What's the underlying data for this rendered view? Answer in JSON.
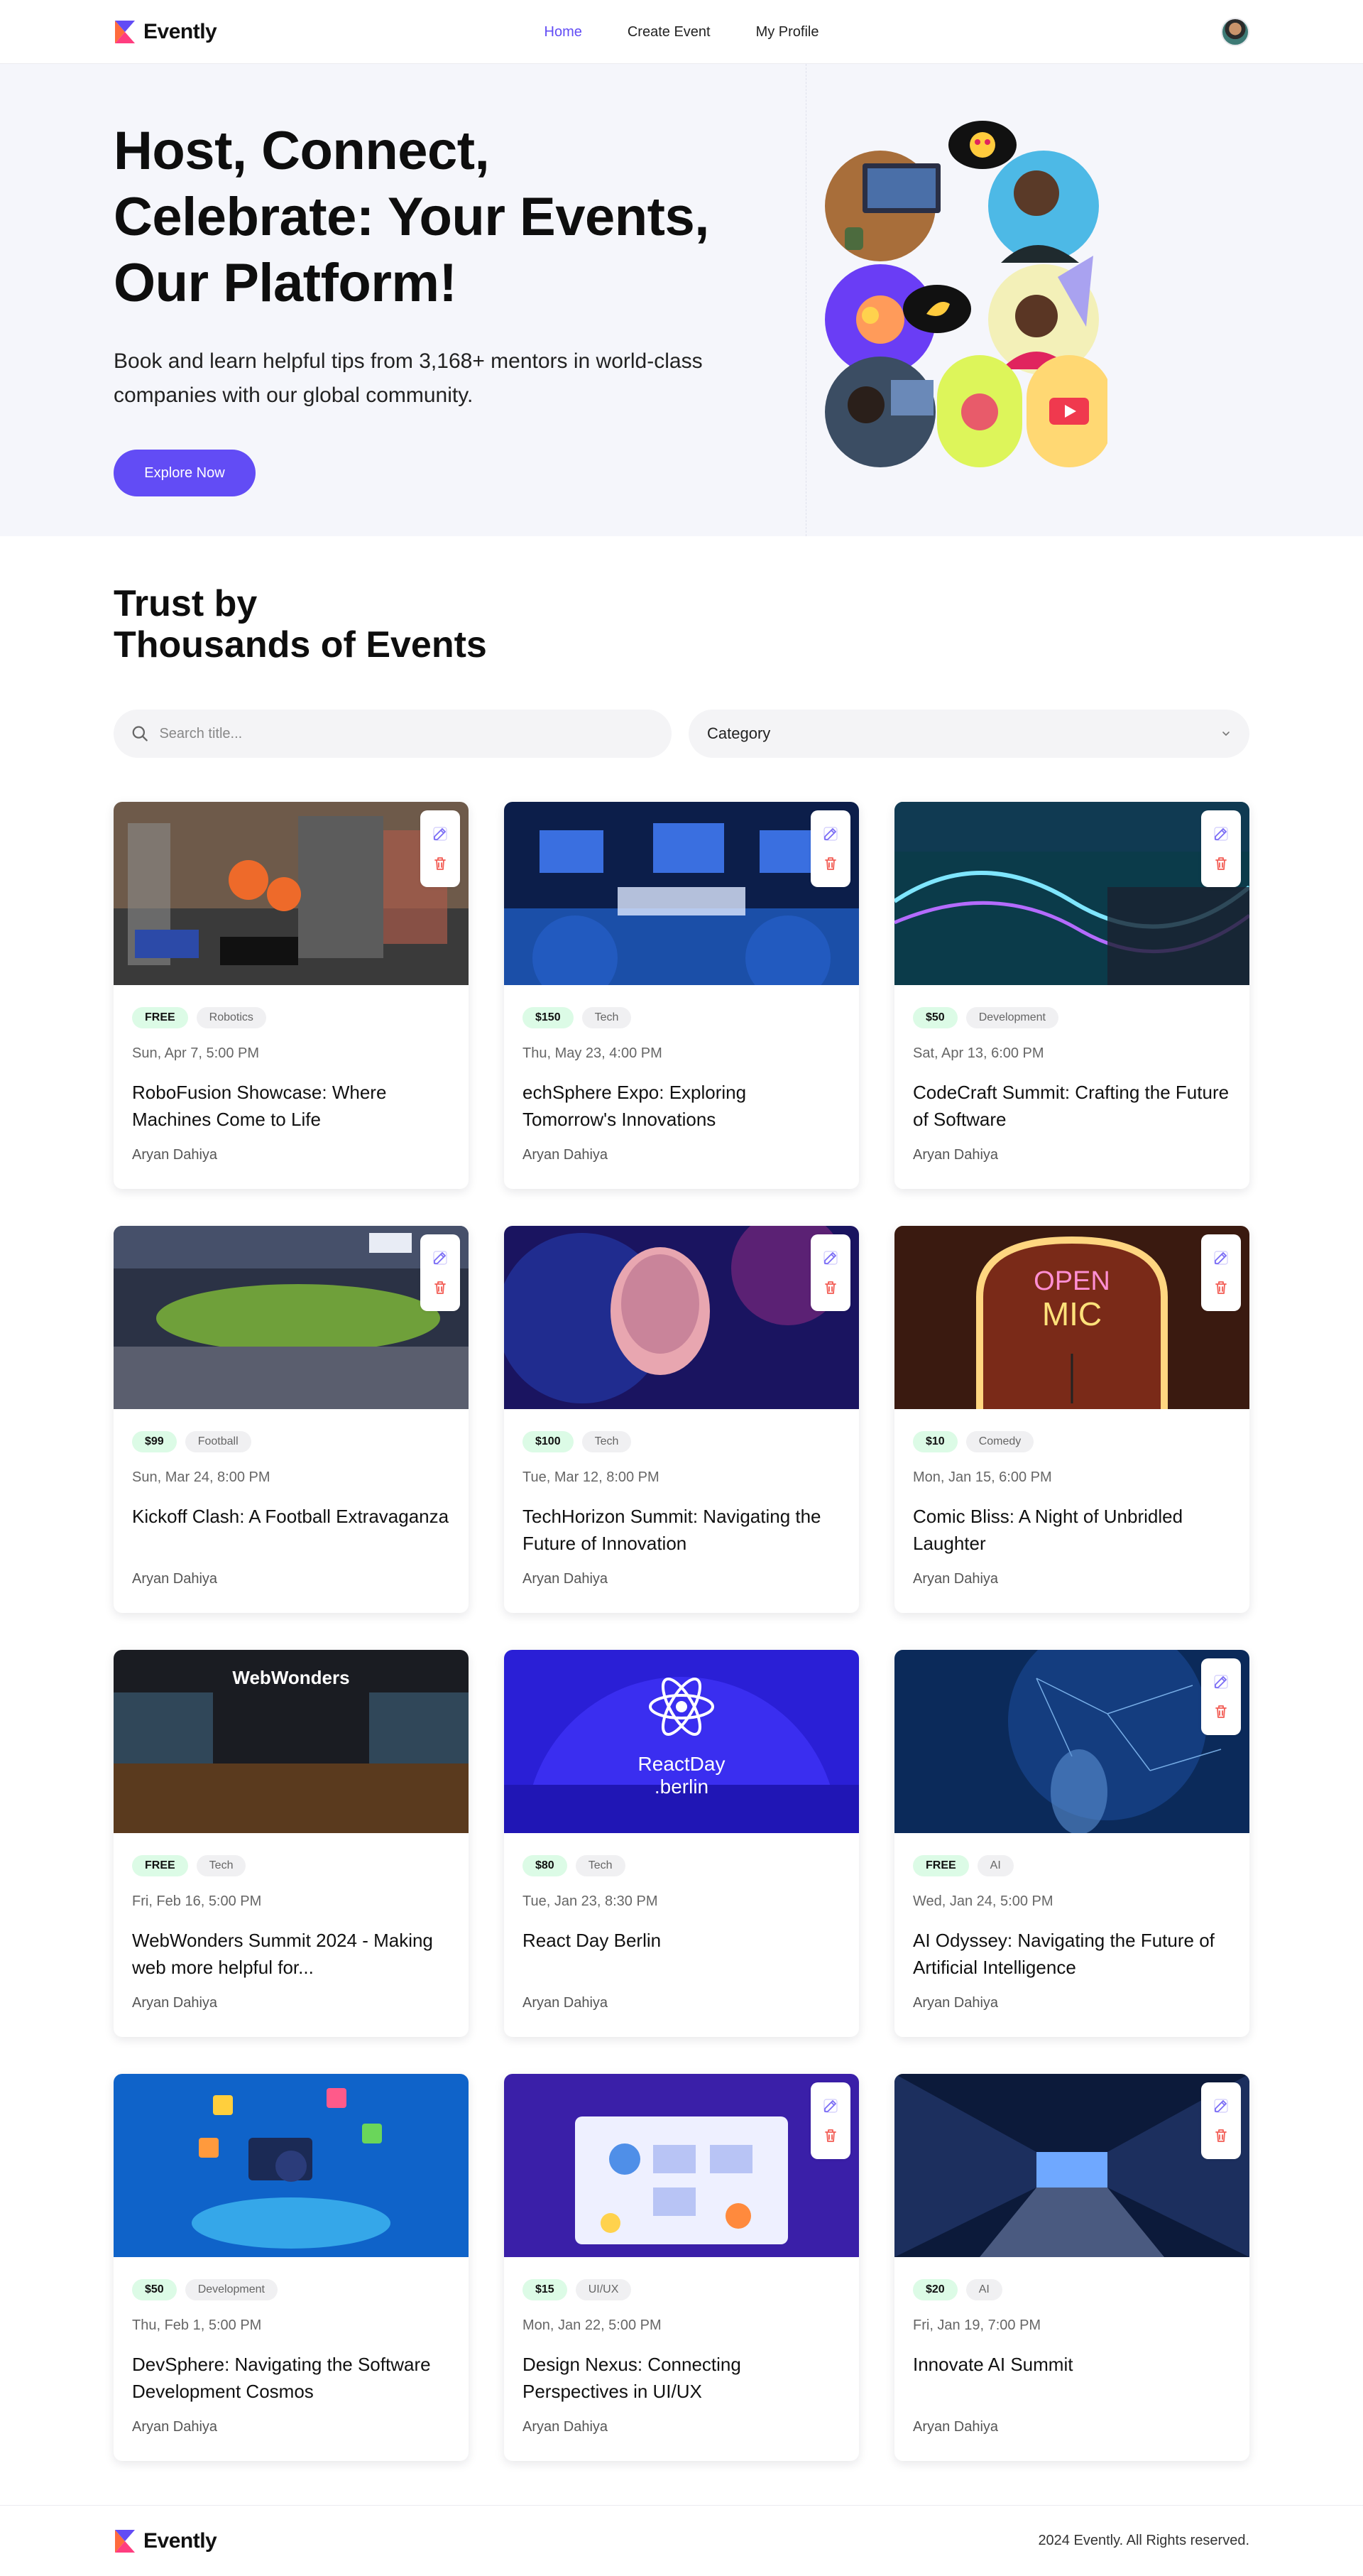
{
  "brand": {
    "name": "Evently",
    "accent": "#624cf5"
  },
  "nav": {
    "home": "Home",
    "create_event": "Create Event",
    "my_profile": "My Profile"
  },
  "hero": {
    "title": "Host, Connect, Celebrate: Your Events, Our Platform!",
    "subtitle": "Book and learn helpful tips from 3,168+ mentors in world-class companies with our global community.",
    "cta": "Explore Now"
  },
  "events_section": {
    "title_line1": "Trust by",
    "title_line2": "Thousands of Events",
    "search_placeholder": "Search title...",
    "category_placeholder": "Category"
  },
  "events": [
    {
      "price": "FREE",
      "category": "Robotics",
      "date": "Sun, Apr 7, 5:00 PM",
      "title": "RoboFusion Showcase: Where Machines Come to Life",
      "organizer": "Aryan Dahiya"
    },
    {
      "price": "$150",
      "category": "Tech",
      "date": "Thu, May 23, 4:00 PM",
      "title": "echSphere Expo: Exploring Tomorrow's Innovations",
      "organizer": "Aryan Dahiya"
    },
    {
      "price": "$50",
      "category": "Development",
      "date": "Sat, Apr 13, 6:00 PM",
      "title": "CodeCraft Summit: Crafting the Future of Software",
      "organizer": "Aryan Dahiya"
    },
    {
      "price": "$99",
      "category": "Football",
      "date": "Sun, Mar 24, 8:00 PM",
      "title": "Kickoff Clash: A Football Extravaganza",
      "organizer": "Aryan Dahiya"
    },
    {
      "price": "$100",
      "category": "Tech",
      "date": "Tue, Mar 12, 8:00 PM",
      "title": "TechHorizon Summit: Navigating the Future of Innovation",
      "organizer": "Aryan Dahiya"
    },
    {
      "price": "$10",
      "category": "Comedy",
      "date": "Mon, Jan 15, 6:00 PM",
      "title": "Comic Bliss: A Night of Unbridled Laughter",
      "organizer": "Aryan Dahiya",
      "image_text": [
        "OPEN",
        "MIC"
      ]
    },
    {
      "price": "FREE",
      "category": "Tech",
      "date": "Fri, Feb 16, 5:00 PM",
      "title": "WebWonders Summit 2024 - Making web more helpful for...",
      "organizer": "Aryan Dahiya",
      "image_text": [
        "WebWonders"
      ]
    },
    {
      "price": "$80",
      "category": "Tech",
      "date": "Tue, Jan 23, 8:30 PM",
      "title": "React Day Berlin",
      "organizer": "Aryan Dahiya",
      "image_text": [
        "ReactDay",
        ".berlin"
      ]
    },
    {
      "price": "FREE",
      "category": "AI",
      "date": "Wed, Jan 24, 5:00 PM",
      "title": "AI Odyssey: Navigating the Future of Artificial Intelligence",
      "organizer": "Aryan Dahiya"
    },
    {
      "price": "$50",
      "category": "Development",
      "date": "Thu, Feb 1, 5:00 PM",
      "title": "DevSphere: Navigating the Software Development Cosmos",
      "organizer": "Aryan Dahiya"
    },
    {
      "price": "$15",
      "category": "UI/UX",
      "date": "Mon, Jan 22, 5:00 PM",
      "title": "Design Nexus: Connecting Perspectives in UI/UX",
      "organizer": "Aryan Dahiya"
    },
    {
      "price": "$20",
      "category": "AI",
      "date": "Fri, Jan 19, 7:00 PM",
      "title": "Innovate AI Summit",
      "organizer": "Aryan Dahiya"
    }
  ],
  "footer": {
    "brand": "Evently",
    "copyright": "2024 Evently. All Rights reserved."
  }
}
